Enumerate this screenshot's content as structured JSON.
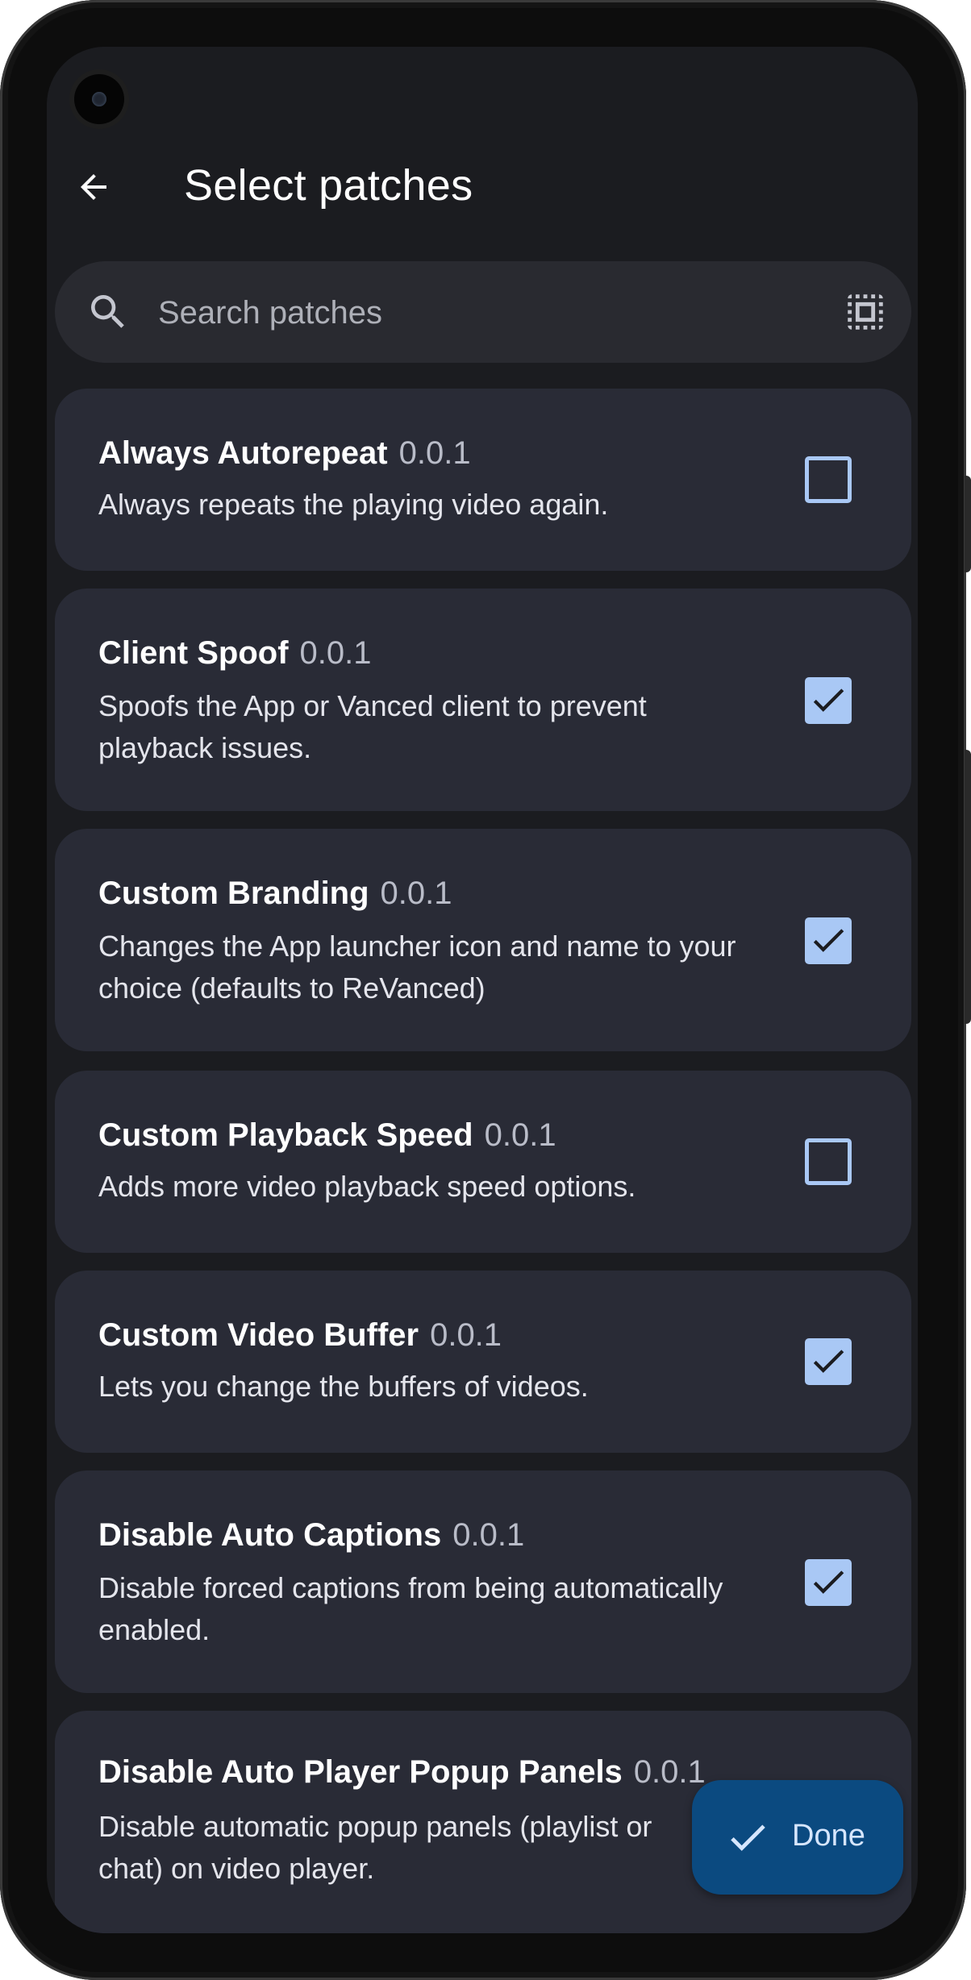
{
  "header": {
    "title": "Select patches",
    "back_icon": "arrow-back-icon"
  },
  "search": {
    "placeholder": "Search patches",
    "value": "",
    "search_icon": "search-icon",
    "filter_icon": "select-all-icon"
  },
  "patches": [
    {
      "name": "Always Autorepeat",
      "version": "0.0.1",
      "description": "Always repeats the playing video again.",
      "selected": false
    },
    {
      "name": "Client Spoof",
      "version": "0.0.1",
      "description": "Spoofs the App or Vanced client to prevent playback issues.",
      "selected": true
    },
    {
      "name": "Custom Branding",
      "version": "0.0.1",
      "description": "Changes the App launcher icon and name to your choice (defaults to ReVanced)",
      "selected": true
    },
    {
      "name": "Custom Playback Speed",
      "version": "0.0.1",
      "description": "Adds more video playback speed options.",
      "selected": false
    },
    {
      "name": "Custom Video Buffer",
      "version": "0.0.1",
      "description": "Lets you change the buffers of videos.",
      "selected": true
    },
    {
      "name": "Disable Auto Captions",
      "version": "0.0.1",
      "description": "Disable forced captions from being automatically enabled.",
      "selected": true
    },
    {
      "name": "Disable Auto Player Popup Panels",
      "version": "0.0.1",
      "description": "Disable automatic popup panels (playlist or chat) on video player.",
      "selected": false
    }
  ],
  "fab": {
    "label": "Done",
    "icon": "check-icon"
  },
  "colors": {
    "background": "#1b1c20",
    "card": "#292b36",
    "accent": "#a9c8f5",
    "fab": "#0b4a80"
  }
}
